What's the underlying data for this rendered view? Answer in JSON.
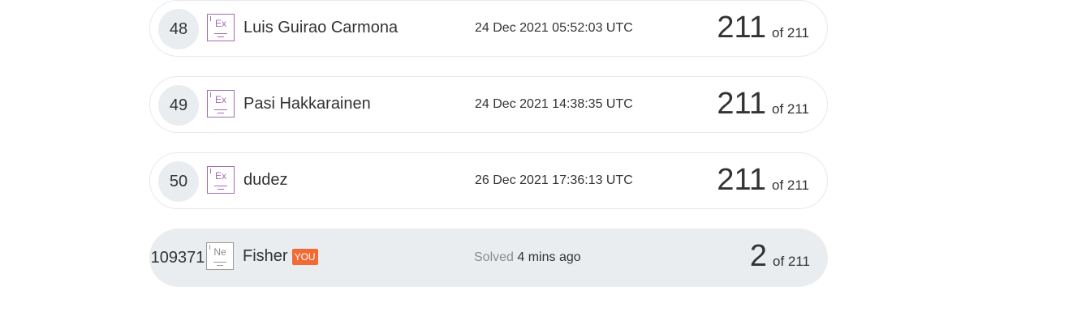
{
  "rows": [
    {
      "rank": "48",
      "badge": "Ex",
      "name": "Luis Guirao Carmona",
      "date": "24 Dec 2021 05:52:03 UTC",
      "solved": "211",
      "of": "of 211"
    },
    {
      "rank": "49",
      "badge": "Ex",
      "name": "Pasi Hakkarainen",
      "date": "24 Dec 2021 14:38:35 UTC",
      "solved": "211",
      "of": "of 211"
    },
    {
      "rank": "50",
      "badge": "Ex",
      "name": "dudez",
      "date": "26 Dec 2021 17:36:13 UTC",
      "solved": "211",
      "of": "of 211"
    }
  ],
  "you_row": {
    "rank": "109371",
    "badge": "Ne",
    "name": "Fisher",
    "you_tag": "YOU",
    "solved_label": "Solved",
    "solved_time": "4 mins ago",
    "solved": "2",
    "of": "of 211"
  },
  "colors": {
    "expert_badge": "#a36ab5",
    "newbie_badge": "#9a9a9a",
    "you_tag": "#f26b35",
    "you_row_bg": "#e9edf0"
  }
}
